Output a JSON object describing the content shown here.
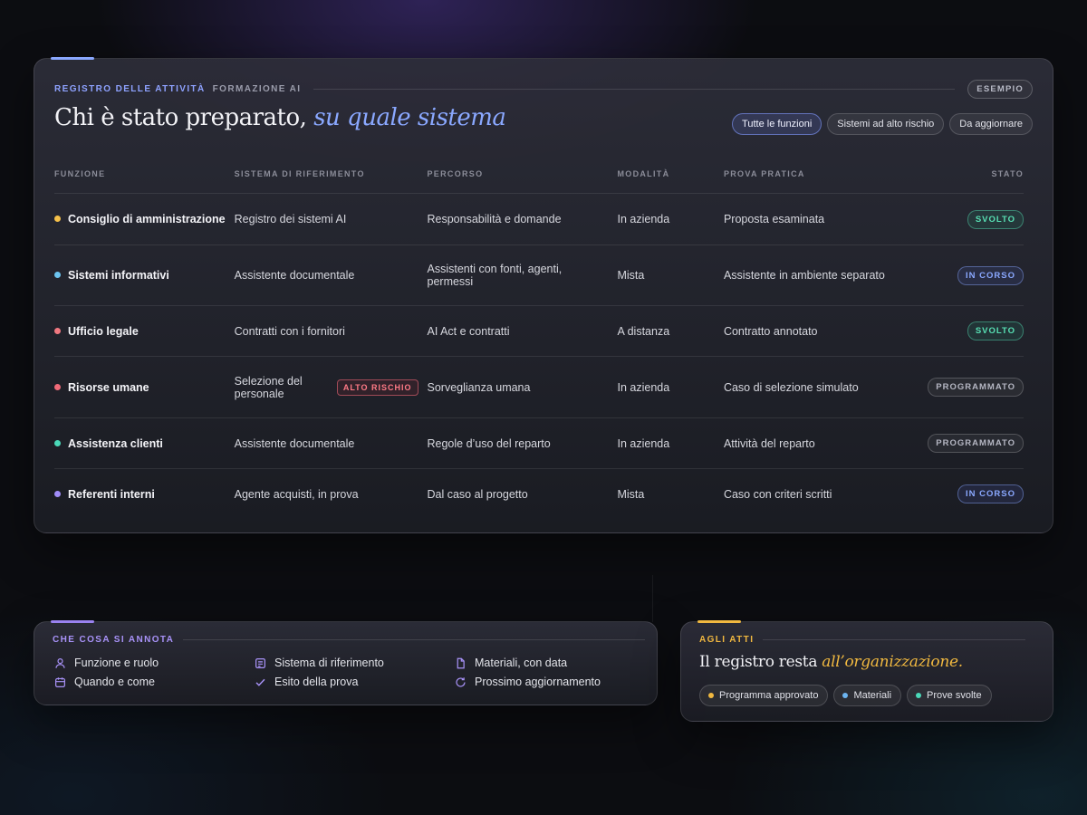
{
  "main": {
    "eyebrow": "REGISTRO DELLE ATTIVITÀ",
    "eyebrow_sub": "FORMAZIONE AI",
    "example_badge": "ESEMPIO",
    "title": "Chi è stato preparato,",
    "title_italic": "su quale sistema",
    "filters": [
      "Tutte le funzioni",
      "Sistemi ad alto rischio",
      "Da aggiornare"
    ],
    "columns": [
      "FUNZIONE",
      "SISTEMA DI RIFERIMENTO",
      "PERCORSO",
      "MODALITÀ",
      "PROVA PRATICA",
      "STATO"
    ],
    "rows": [
      {
        "funzione": "Consiglio di amministrazione",
        "dot_color": "#f5c04a",
        "sistema": "Registro dei sistemi AI",
        "percorso": "Responsabilità e domande",
        "modalita": "In azienda",
        "prova": "Proposta esaminata",
        "stato": "SVOLTO"
      },
      {
        "funzione": "Sistemi informativi",
        "dot_color": "#6cc4f0",
        "sistema": "Assistente documentale",
        "percorso": "Assistenti con fonti, agenti, permessi",
        "modalita": "Mista",
        "prova": "Assistente in ambiente separato",
        "stato": "IN CORSO"
      },
      {
        "funzione": "Ufficio legale",
        "dot_color": "#f07880",
        "sistema": "Contratti con i fornitori",
        "percorso": "AI Act e contratti",
        "modalita": "A distanza",
        "prova": "Contratto annotato",
        "stato": "SVOLTO"
      },
      {
        "funzione": "Risorse umane",
        "dot_color": "#f06a78",
        "sistema": "Selezione del personale",
        "risk": "ALTO RISCHIO",
        "percorso": "Sorveglianza umana",
        "modalita": "In azienda",
        "prova": "Caso di selezione simulato",
        "stato": "PROGRAMMATO"
      },
      {
        "funzione": "Assistenza clienti",
        "dot_color": "#4ad8b8",
        "sistema": "Assistente documentale",
        "percorso": "Regole d’uso del reparto",
        "modalita": "In azienda",
        "prova": "Attività del reparto",
        "stato": "PROGRAMMATO"
      },
      {
        "funzione": "Referenti interni",
        "dot_color": "#a08cf8",
        "sistema": "Agente acquisti, in prova",
        "percorso": "Dal caso al progetto",
        "modalita": "Mista",
        "prova": "Caso con criteri scritti",
        "stato": "IN CORSO"
      }
    ]
  },
  "notes": {
    "label": "CHE COSA SI ANNOTA",
    "items": [
      {
        "icon": "user-icon",
        "text": "Funzione e ruolo"
      },
      {
        "icon": "list-icon",
        "text": "Sistema di riferimento"
      },
      {
        "icon": "file-icon",
        "text": "Materiali, con data"
      },
      {
        "icon": "calendar-icon",
        "text": "Quando e come"
      },
      {
        "icon": "check-icon",
        "text": "Esito della prova"
      },
      {
        "icon": "refresh-icon",
        "text": "Prossimo aggiornamento"
      }
    ]
  },
  "record": {
    "label": "AGLI ATTI",
    "title": "Il registro resta",
    "title_italic": "all’organizzazione.",
    "chips": [
      {
        "text": "Programma approvato",
        "color": "#f0b840"
      },
      {
        "text": "Materiali",
        "color": "#6cb4f0"
      },
      {
        "text": "Prove svolte",
        "color": "#4ad8b8"
      }
    ]
  },
  "colors": {
    "accent": "#8aa8ff",
    "done": "#58e0b4",
    "gold": "#f0b840"
  }
}
